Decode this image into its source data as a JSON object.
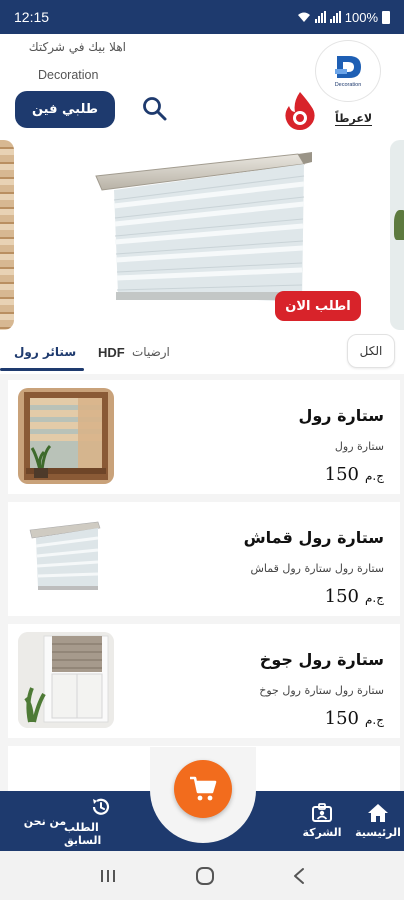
{
  "status_bar": {
    "time": "12:15",
    "battery": "100%",
    "signal_icon": "signal-icon",
    "wifi_icon": "wifi-icon",
    "battery_icon": "battery-icon"
  },
  "header": {
    "greeting": "اهلا بيك في شركتك",
    "greeting_sub": "Decoration",
    "order_technician": "طلبي فين",
    "search_icon": "search-icon",
    "logo_text": "Decoration",
    "offers_label": "لاعرطاً",
    "offers_icon": "hot-offer-icon",
    "accent": "#1e3a6e",
    "offer_color": "#d8232a"
  },
  "carousel": {
    "order_now": "اطلب الان"
  },
  "tabs": {
    "items": [
      "ستائر رول",
      "HDF",
      "ارضيات"
    ],
    "all": "الكل"
  },
  "products": [
    {
      "title": "ستارة رول",
      "desc": "ستارة رول",
      "price": "150",
      "currency": "ج.م"
    },
    {
      "title": "ستارة رول قماش",
      "desc": "ستارة رول ستارة رول قماش",
      "price": "150",
      "currency": "ج.م"
    },
    {
      "title": "ستارة رول جوخ",
      "desc": "ستارة رول ستارة رول جوخ",
      "price": "150",
      "currency": "ج.م"
    }
  ],
  "bottom_nav": {
    "home": "الرئيسية",
    "company": "الشركة",
    "previous_orders": "الطلب السابق",
    "about": "من نحن",
    "cart_icon": "cart-icon",
    "fab_color": "#f26c1d"
  }
}
